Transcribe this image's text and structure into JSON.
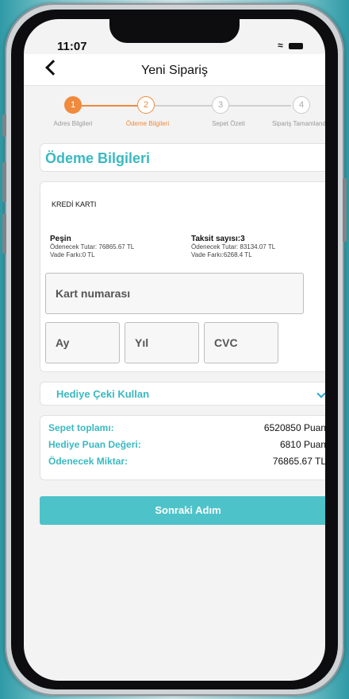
{
  "status": {
    "time": "11:07"
  },
  "header": {
    "title": "Yeni Sipariş"
  },
  "steps": [
    {
      "num": "1",
      "label": "Adres Bilgileri"
    },
    {
      "num": "2",
      "label": "Ödeme Bilgileri"
    },
    {
      "num": "3",
      "label": "Sepet Özeti"
    },
    {
      "num": "4",
      "label": "Sipariş Tamamlandı"
    }
  ],
  "payment": {
    "title": "Ödeme Bilgileri",
    "card_type": "KREDİ KARTI",
    "option_1": {
      "title": "Peşin",
      "line1": "Ödenecek Tutar: 76865.67 TL",
      "line2": "Vade Farkı:0 TL"
    },
    "option_2": {
      "title": "Taksit sayısı:3",
      "line1": "Ödenecek Tutar: 83134.07 TL",
      "line2": "Vade Farkı:6268.4 TL"
    },
    "card_number_placeholder": "Kart numarası",
    "month_placeholder": "Ay",
    "year_placeholder": "Yıl",
    "cvc_placeholder": "CVC"
  },
  "gift": {
    "label": "Hediye Çeki Kullan"
  },
  "summary": [
    {
      "key": "Sepet toplamı:",
      "value": "6520850 Puan"
    },
    {
      "key": "Hediye Puan Değeri:",
      "value": "6810 Puan"
    },
    {
      "key": "Ödenecek Miktar:",
      "value": "76865.67 TL"
    }
  ],
  "next_button": "Sonraki Adım",
  "colors": {
    "accent": "#39b9c1",
    "step_active": "#f08a3c",
    "button": "#4dc3c9"
  }
}
